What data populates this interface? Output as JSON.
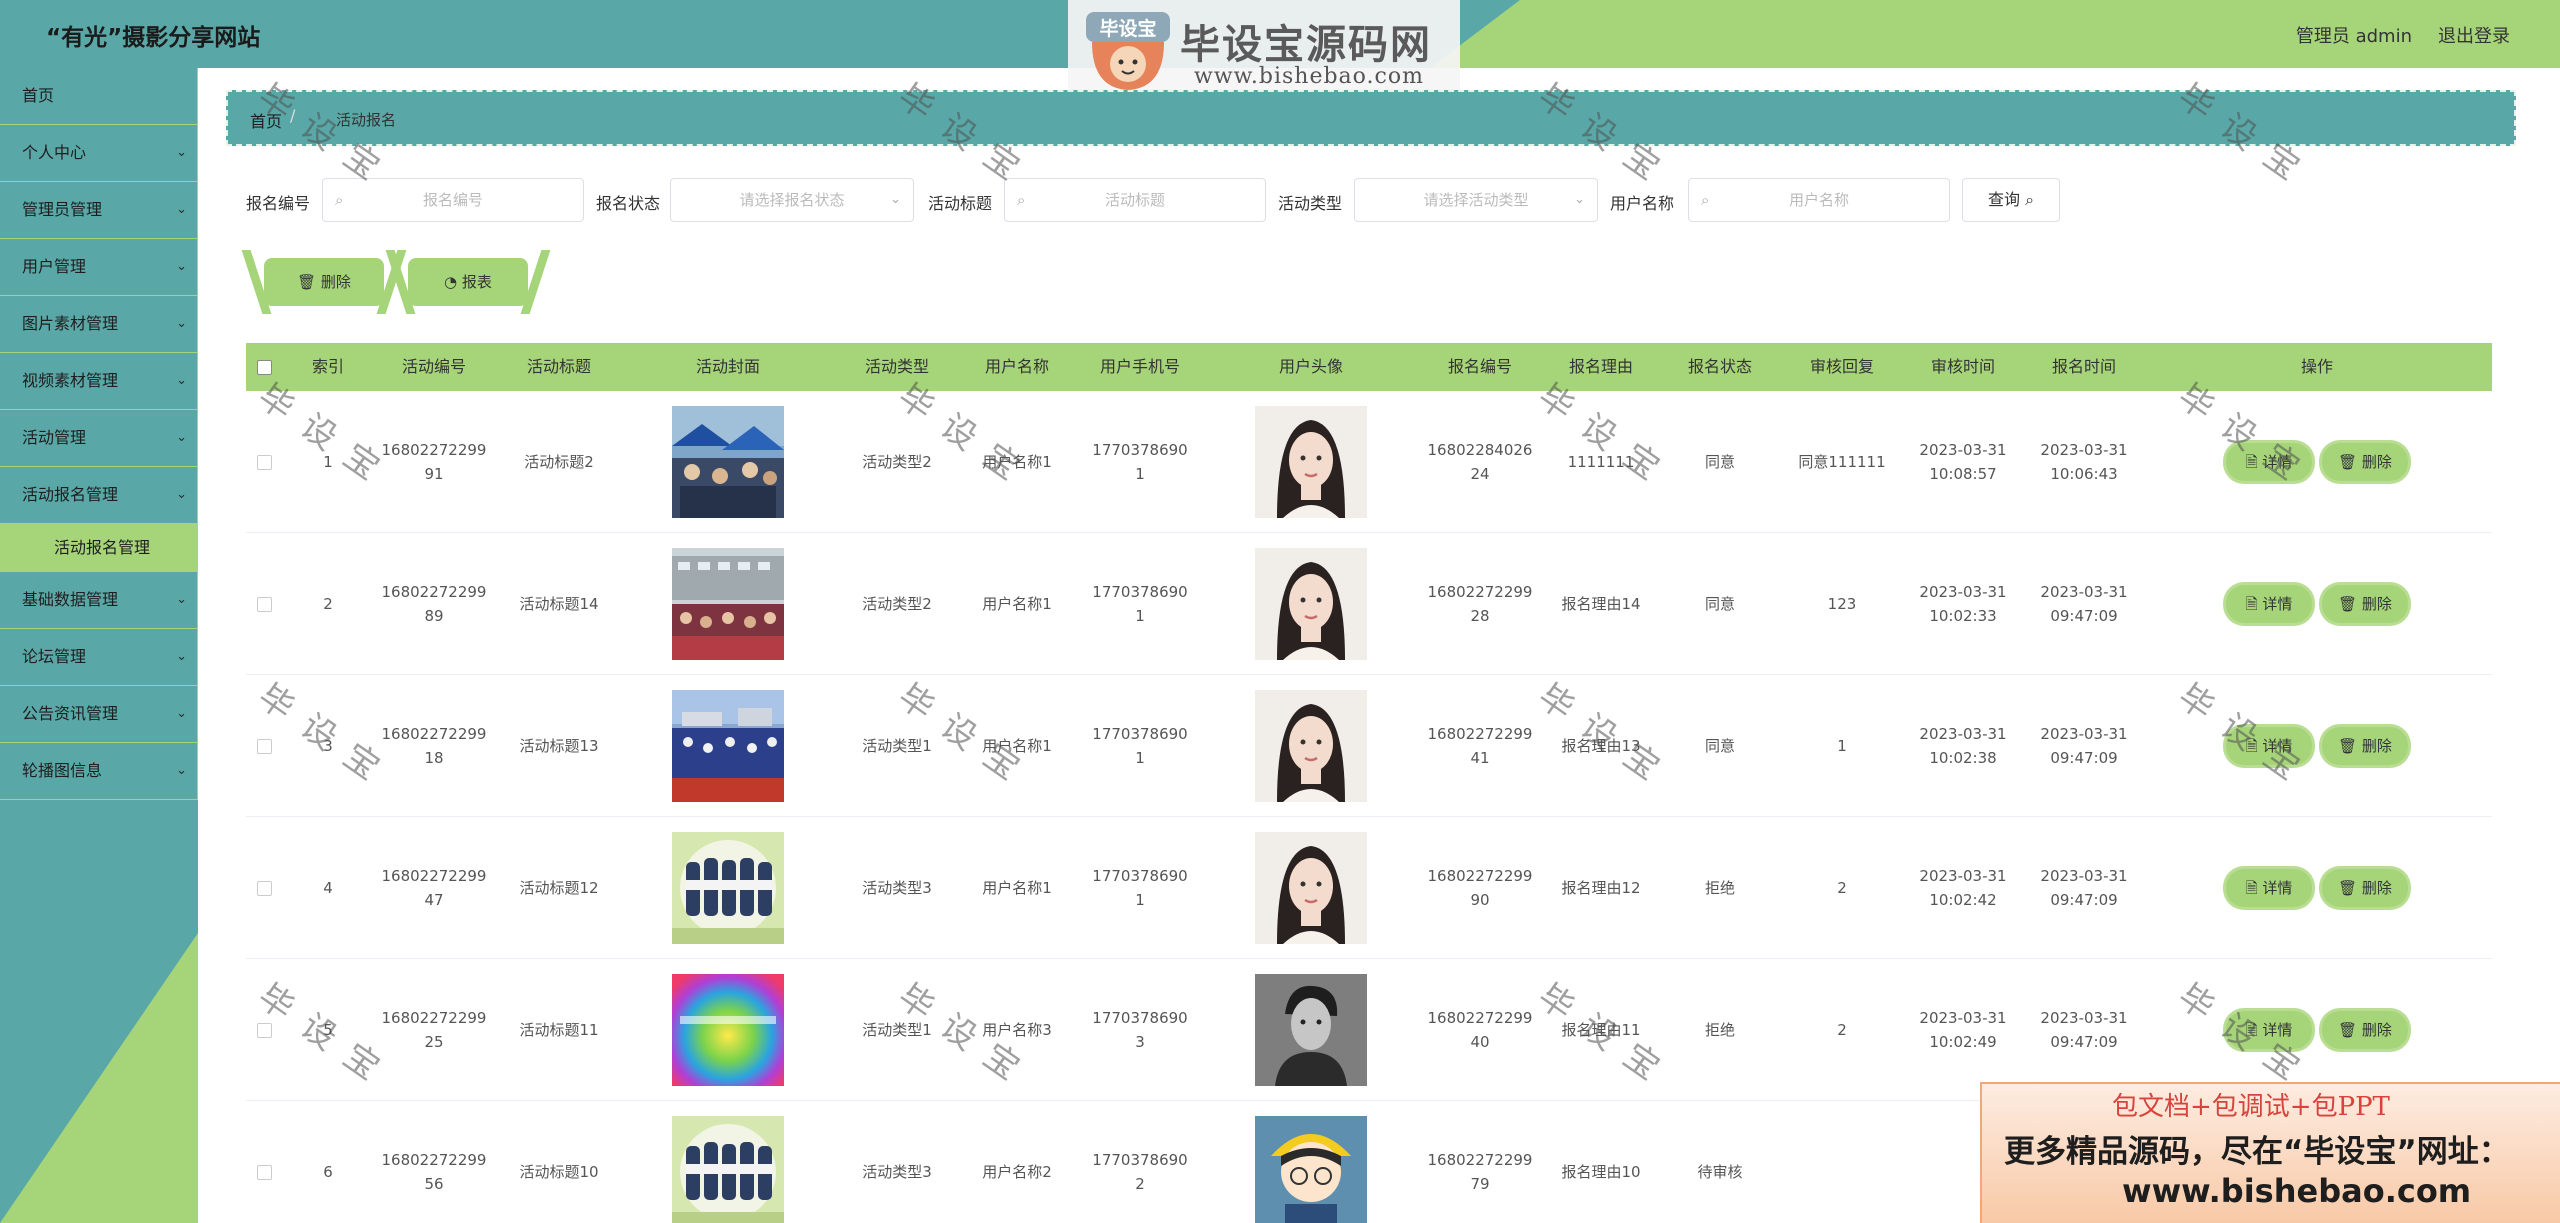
{
  "header": {
    "site_title": "“有光”摄影分享网站",
    "admin_label": "管理员 admin",
    "logout_label": "退出登录",
    "logo": {
      "badge_text": "毕设宝",
      "name": "毕设宝源码网",
      "url": "www.bishebao.com"
    }
  },
  "sidebar": {
    "items": [
      {
        "label": "首页",
        "arrow": false
      },
      {
        "label": "个人中心",
        "arrow": true
      },
      {
        "label": "管理员管理",
        "arrow": true
      },
      {
        "label": "用户管理",
        "arrow": true
      },
      {
        "label": "图片素材管理",
        "arrow": true
      },
      {
        "label": "视频素材管理",
        "arrow": true
      },
      {
        "label": "活动管理",
        "arrow": true
      },
      {
        "label": "活动报名管理",
        "arrow": true
      }
    ],
    "active_sub": "活动报名管理",
    "items_after": [
      {
        "label": "基础数据管理",
        "arrow": true
      },
      {
        "label": "论坛管理",
        "arrow": true
      },
      {
        "label": "公告资讯管理",
        "arrow": true
      },
      {
        "label": "轮播图信息",
        "arrow": true
      }
    ]
  },
  "breadcrumb": {
    "home": "首页",
    "separator": "/",
    "current": "活动报名"
  },
  "filters": {
    "enroll_no_label": "报名编号",
    "enroll_no_placeholder": "报名编号",
    "status_label": "报名状态",
    "status_placeholder": "请选择报名状态",
    "title_label": "活动标题",
    "title_placeholder": "活动标题",
    "type_label": "活动类型",
    "type_placeholder": "请选择活动类型",
    "user_label": "用户名称",
    "user_placeholder": "用户名称",
    "query_label": "查询"
  },
  "actions": {
    "delete_label": "删除",
    "report_label": "报表"
  },
  "table": {
    "headers": [
      "索引",
      "活动编号",
      "活动标题",
      "活动封面",
      "活动类型",
      "用户名称",
      "用户手机号",
      "用户头像",
      "报名编号",
      "报名理由",
      "报名状态",
      "审核回复",
      "审核时间",
      "报名时间",
      "操作"
    ],
    "detail_label": "详情",
    "delete_label": "删除",
    "rows": [
      {
        "index": "1",
        "activity_no": "1680227229991",
        "title": "活动标题2",
        "cover": "crowd-tents",
        "type": "活动类型2",
        "user": "用户名称1",
        "phone": "17703786901",
        "avatar": "woman-portrait",
        "enroll_no": "1680228402624",
        "reason": "1111111",
        "status": "同意",
        "reply": "同意111111",
        "audit_time": "2023-03-31 10:08:57",
        "enroll_time": "2023-03-31 10:06:43"
      },
      {
        "index": "2",
        "activity_no": "1680227229989",
        "title": "活动标题14",
        "cover": "crowd-building",
        "type": "活动类型2",
        "user": "用户名称1",
        "phone": "17703786901",
        "avatar": "woman-portrait",
        "enroll_no": "1680227229928",
        "reason": "报名理由14",
        "status": "同意",
        "reply": "123",
        "audit_time": "2023-03-31 10:02:33",
        "enroll_time": "2023-03-31 09:47:09"
      },
      {
        "index": "3",
        "activity_no": "1680227229918",
        "title": "活动标题13",
        "cover": "crowd-field",
        "type": "活动类型1",
        "user": "用户名称1",
        "phone": "17703786901",
        "avatar": "woman-portrait",
        "enroll_no": "1680227229941",
        "reason": "报名理由13",
        "status": "同意",
        "reply": "1",
        "audit_time": "2023-03-31 10:02:38",
        "enroll_time": "2023-03-31 09:47:09"
      },
      {
        "index": "4",
        "activity_no": "1680227229947",
        "title": "活动标题12",
        "cover": "students-group",
        "type": "活动类型3",
        "user": "用户名称1",
        "phone": "17703786901",
        "avatar": "woman-portrait",
        "enroll_no": "1680227229990",
        "reason": "报名理由12",
        "status": "拒绝",
        "reply": "2",
        "audit_time": "2023-03-31 10:02:42",
        "enroll_time": "2023-03-31 09:47:09"
      },
      {
        "index": "5",
        "activity_no": "1680227229925",
        "title": "活动标题11",
        "cover": "rainbow-poster",
        "type": "活动类型1",
        "user": "用户名称3",
        "phone": "17703786903",
        "avatar": "man-portrait",
        "enroll_no": "1680227229940",
        "reason": "报名理由11",
        "status": "拒绝",
        "reply": "2",
        "audit_time": "2023-03-31 10:02:49",
        "enroll_time": "2023-03-31 09:47:09"
      },
      {
        "index": "6",
        "activity_no": "1680227229956",
        "title": "活动标题10",
        "cover": "students-group",
        "type": "活动类型3",
        "user": "用户名称2",
        "phone": "17703786902",
        "avatar": "cartoon-boy",
        "enroll_no": "1680227229979",
        "reason": "报名理由10",
        "status": "待审核",
        "reply": "",
        "audit_time": "",
        "enroll_time": ""
      }
    ]
  },
  "watermark": "毕设宝",
  "promo": {
    "line1": "包文档+包调试+包PPT",
    "line2": "更多精品源码，尽在“毕设宝”网址：",
    "line3": "www.bishebao.com"
  },
  "colors": {
    "teal": "#5aa7a7",
    "green": "#a6d579"
  }
}
